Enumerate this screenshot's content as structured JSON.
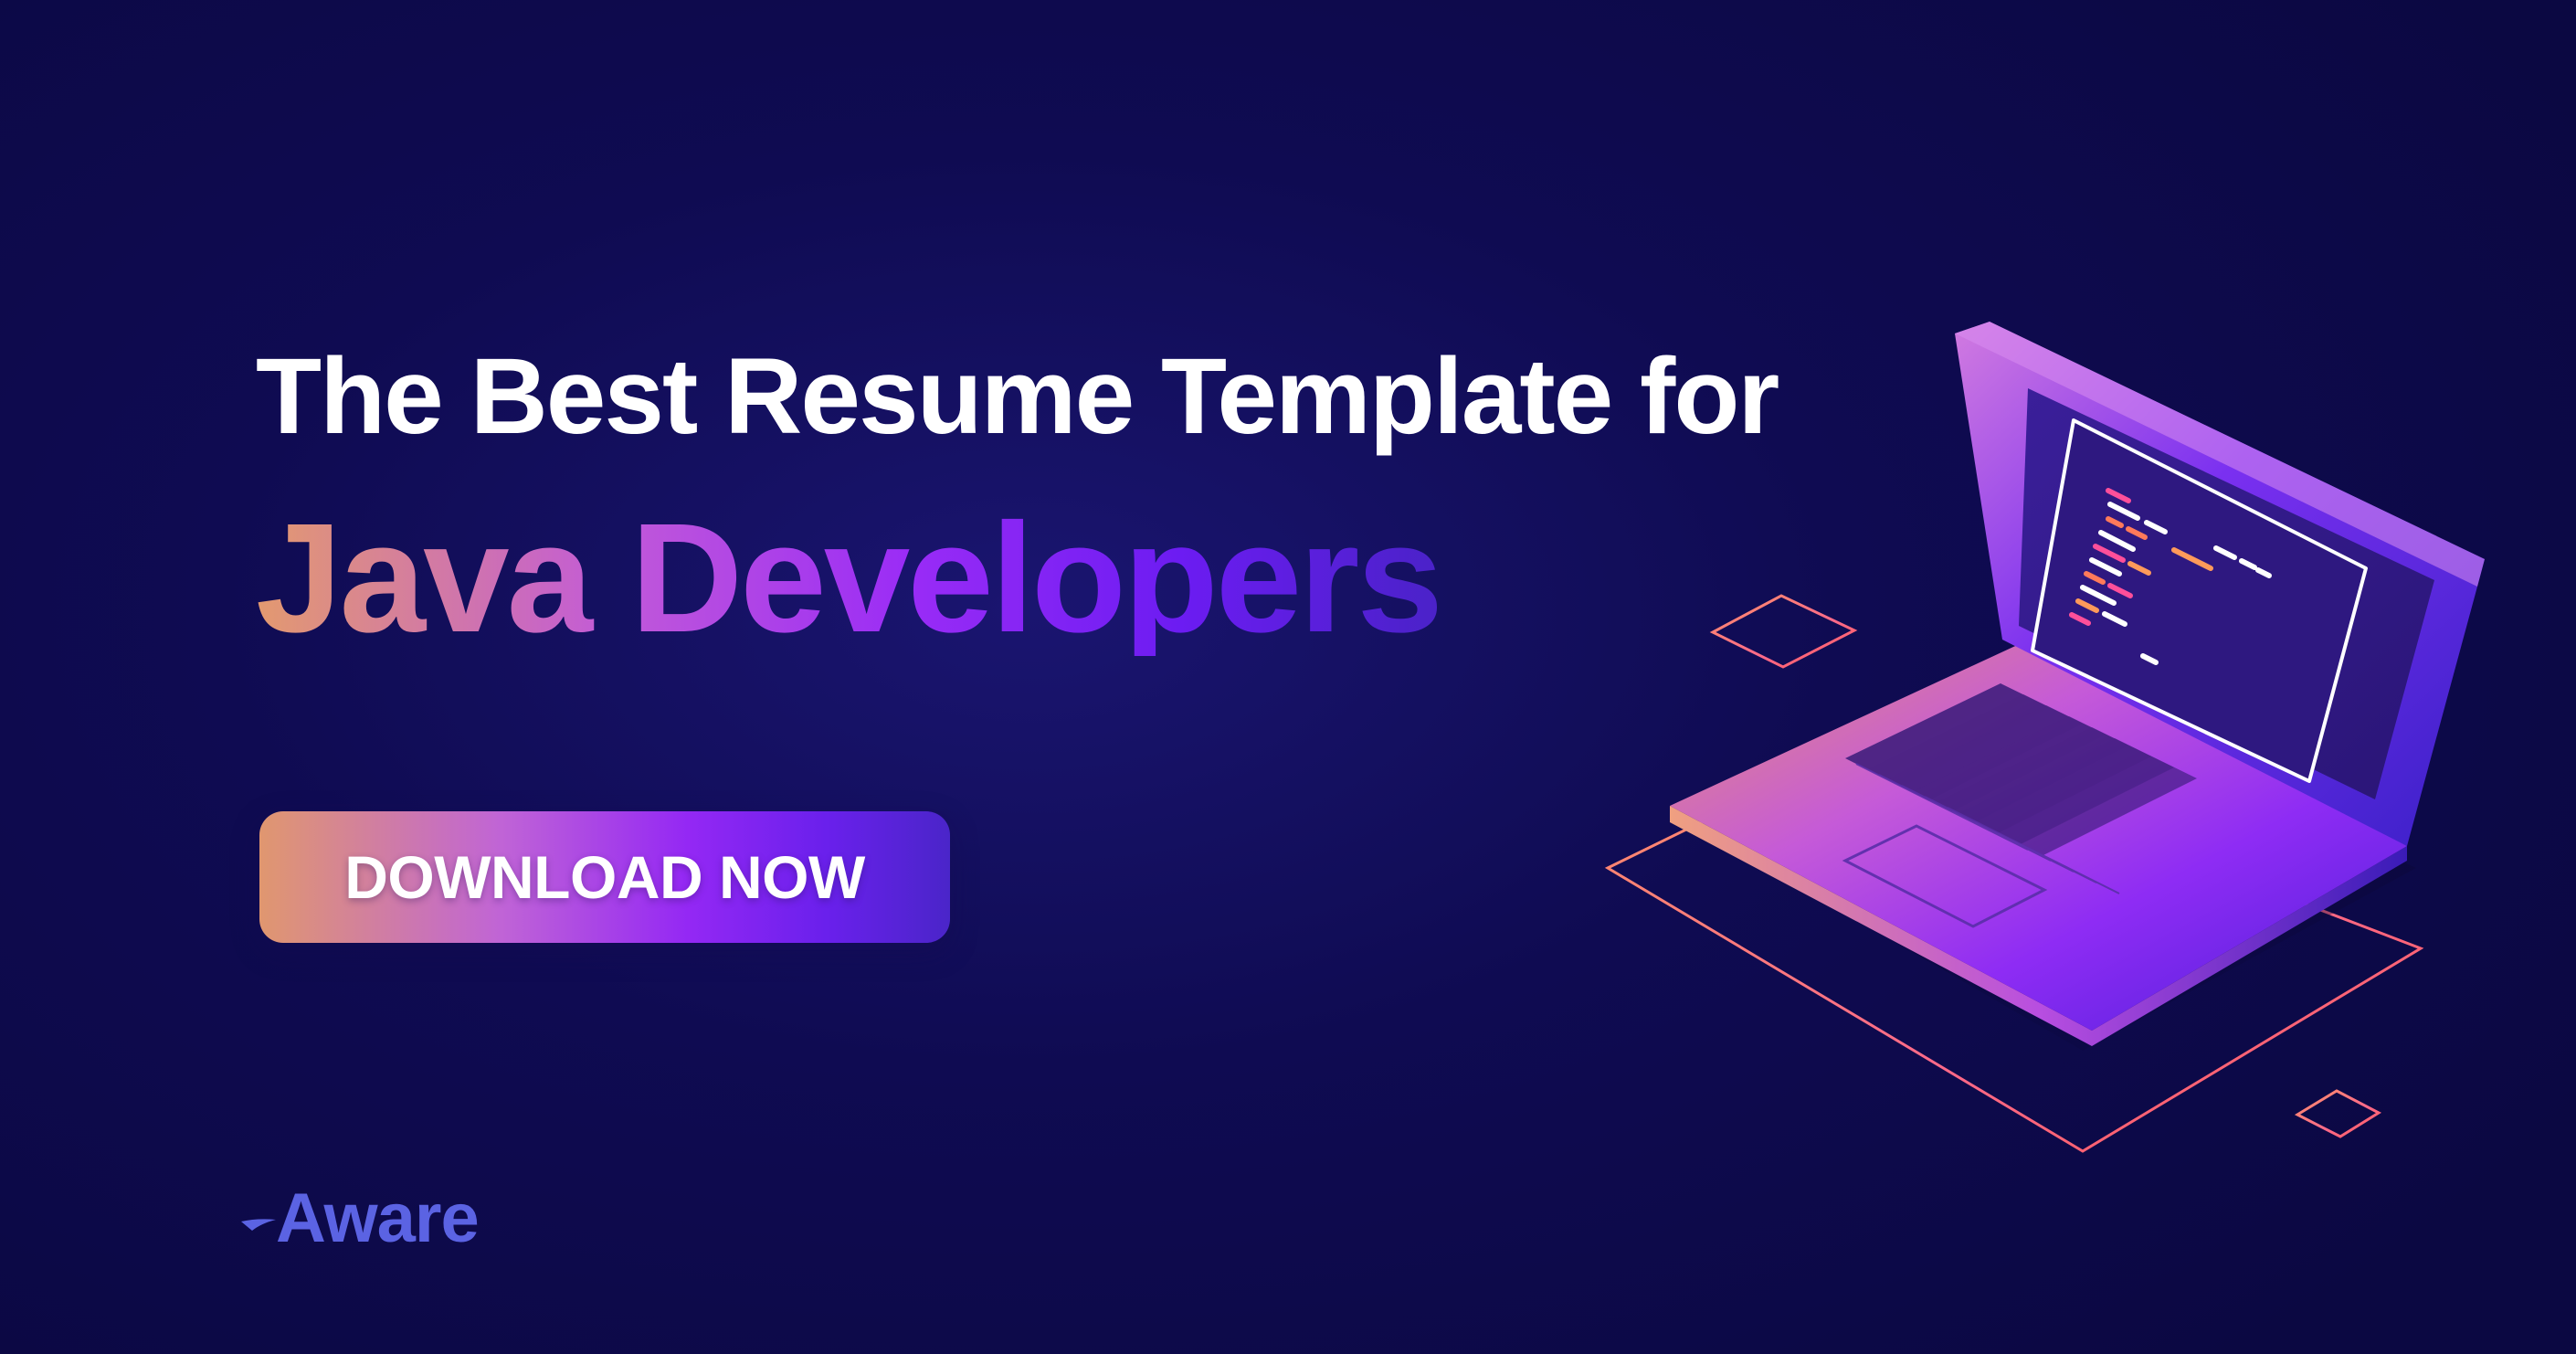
{
  "banner": {
    "headline_line1": "The Best Resume Template for",
    "headline_line2": "Java Developers",
    "cta_label": "DOWNLOAD NOW",
    "logo_text": "Aware"
  },
  "colors": {
    "background": "#0f0b52",
    "headline": "#ffffff",
    "gradient_start": "#e39a6f",
    "gradient_mid": "#9a2cf6",
    "gradient_end": "#4a22c8",
    "logo": "#5b63e3"
  },
  "icons": {
    "logo_mark": "star-swoosh-icon",
    "illustration": "laptop-illustration"
  }
}
